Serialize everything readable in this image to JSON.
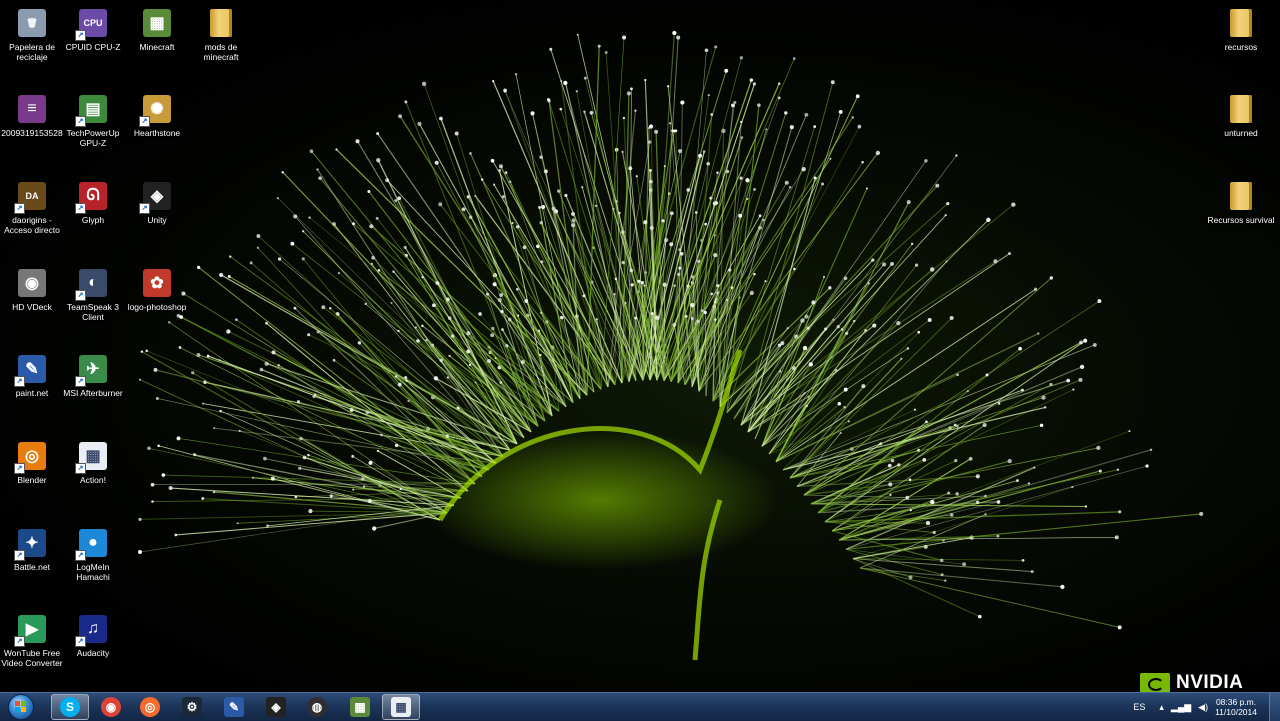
{
  "desktop": {
    "icons": [
      {
        "id": "recycle-bin",
        "label": "Papelera de reciclaje",
        "shortcut": false,
        "color": "#8a9bb0",
        "glyph": "🗑"
      },
      {
        "id": "cpuz",
        "label": "CPUID CPU-Z",
        "shortcut": true,
        "color": "#6b4aa8",
        "glyph": "CPU"
      },
      {
        "id": "minecraft",
        "label": "Minecraft",
        "shortcut": false,
        "color": "#5a8a3a",
        "glyph": "▦"
      },
      {
        "id": "mods-folder",
        "label": "mods de minecraft",
        "shortcut": false,
        "color": "#e3bb55",
        "glyph": ""
      },
      {
        "id": "winrar-file",
        "label": "2009319153528",
        "shortcut": false,
        "color": "#7a3a8a",
        "glyph": "≡"
      },
      {
        "id": "gpuz",
        "label": "TechPowerUp GPU-Z",
        "shortcut": true,
        "color": "#3d8a3d",
        "glyph": "▤"
      },
      {
        "id": "hearthstone",
        "label": "Hearthstone",
        "shortcut": true,
        "color": "#c79a3a",
        "glyph": "✺"
      },
      {
        "id": "daorigins",
        "label": "daorigins - Acceso directo",
        "shortcut": true,
        "color": "#6a4a1a",
        "glyph": "DA"
      },
      {
        "id": "glyph",
        "label": "Glyph",
        "shortcut": true,
        "color": "#b8232a",
        "glyph": "ᘏ"
      },
      {
        "id": "unity",
        "label": "Unity",
        "shortcut": true,
        "color": "#222222",
        "glyph": "◈"
      },
      {
        "id": "hdvdeck",
        "label": "HD VDeck",
        "shortcut": false,
        "color": "#777777",
        "glyph": "◉"
      },
      {
        "id": "teamspeak",
        "label": "TeamSpeak 3 Client",
        "shortcut": true,
        "color": "#3a4a6a",
        "glyph": "◐"
      },
      {
        "id": "logo-photoshop",
        "label": "logo-photoshop",
        "shortcut": false,
        "color": "#c0392b",
        "glyph": "✿"
      },
      {
        "id": "paintnet",
        "label": "paint.net",
        "shortcut": true,
        "color": "#2a5aa8",
        "glyph": "✎"
      },
      {
        "id": "afterburner",
        "label": "MSI Afterburner",
        "shortcut": true,
        "color": "#3a8a4a",
        "glyph": "✈"
      },
      {
        "id": "blender",
        "label": "Blender",
        "shortcut": true,
        "color": "#e87d0d",
        "glyph": "◎"
      },
      {
        "id": "action",
        "label": "Action!",
        "shortcut": true,
        "color": "#e9eef5",
        "glyph": "▦"
      },
      {
        "id": "battlenet",
        "label": "Battle.net",
        "shortcut": true,
        "color": "#1a4a8a",
        "glyph": "✦"
      },
      {
        "id": "hamachi",
        "label": "LogMeIn Hamachi",
        "shortcut": true,
        "color": "#1e88d8",
        "glyph": "●"
      },
      {
        "id": "wontube",
        "label": "WonTube Free Video Converter",
        "shortcut": true,
        "color": "#2a9a5a",
        "glyph": "▶"
      },
      {
        "id": "audacity",
        "label": "Audacity",
        "shortcut": true,
        "color": "#1a2a8a",
        "glyph": "♫"
      },
      {
        "id": "recursos",
        "label": "recursos",
        "shortcut": false,
        "color": "#e3bb55",
        "glyph": ""
      },
      {
        "id": "unturned",
        "label": "unturned",
        "shortcut": false,
        "color": "#e3bb55",
        "glyph": ""
      },
      {
        "id": "recursos-survival",
        "label": "Recursos survival",
        "shortcut": false,
        "color": "#e3bb55",
        "glyph": ""
      }
    ]
  },
  "wallpaper": {
    "brand": "NVIDIA",
    "accent": "#76b900"
  },
  "taskbar": {
    "pinned": [
      {
        "id": "skype",
        "name": "skype-icon",
        "color": "#00aff0",
        "glyph": "S",
        "active": true
      },
      {
        "id": "chrome",
        "name": "chrome-icon",
        "color": "#db4437",
        "glyph": "◉",
        "active": false
      },
      {
        "id": "origin",
        "name": "origin-icon",
        "color": "#f56c2d",
        "glyph": "◎",
        "active": false
      },
      {
        "id": "steam",
        "name": "steam-icon",
        "color": "#1b2838",
        "glyph": "⚙",
        "active": false
      },
      {
        "id": "paintnet",
        "name": "paintnet-icon",
        "color": "#2a5aa8",
        "glyph": "✎",
        "active": false
      },
      {
        "id": "unity",
        "name": "unity-icon",
        "color": "#222222",
        "glyph": "◈",
        "active": false
      },
      {
        "id": "obs",
        "name": "obs-icon",
        "color": "#302e31",
        "glyph": "◍",
        "active": false
      },
      {
        "id": "minecraft",
        "name": "minecraft-icon",
        "color": "#5a8a3a",
        "glyph": "▦",
        "active": false
      },
      {
        "id": "action",
        "name": "action-icon",
        "color": "#e9eef5",
        "glyph": "▦",
        "active": true
      }
    ],
    "tray": {
      "language": "ES",
      "time": "08:36 p.m.",
      "date": "11/10/2014"
    }
  }
}
